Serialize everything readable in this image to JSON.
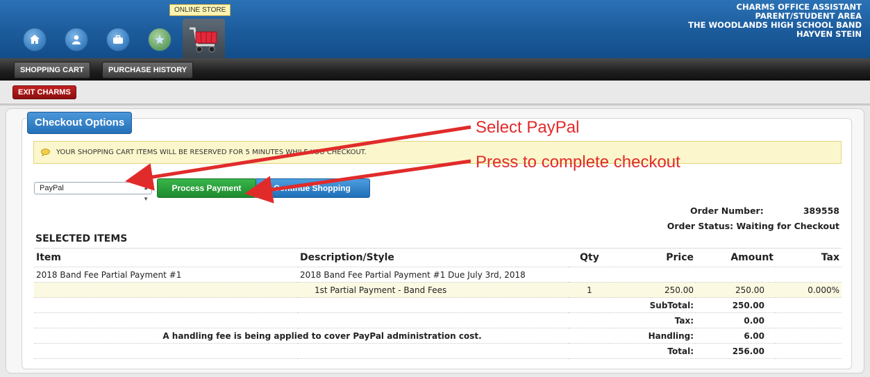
{
  "header": {
    "lines": [
      "CHARMS OFFICE ASSISTANT",
      "PARENT/STUDENT AREA",
      "THE WOODLANDS HIGH SCHOOL BAND",
      "HAYVEN STEIN"
    ],
    "store_tooltip": "ONLINE STORE",
    "icons": [
      "home-icon",
      "person-icon",
      "briefcase-icon",
      "star-icon",
      "shopping-cart-icon"
    ]
  },
  "subnav": {
    "shopping_cart": "SHOPPING CART",
    "purchase_history": "PURCHASE HISTORY",
    "exit": "EXIT CHARMS"
  },
  "checkout": {
    "title": "Checkout Options",
    "notice": "YOUR SHOPPING CART ITEMS WILL BE RESERVED FOR 5 MINUTES WHILE YOU CHECKOUT.",
    "payment_method": "PayPal",
    "process_button": "Process Payment",
    "continue_button": "Continue Shopping"
  },
  "order": {
    "number_label": "Order Number:",
    "number": "389558",
    "status_label": "Order Status:",
    "status": "Waiting for Checkout"
  },
  "items": {
    "section_title": "SELECTED ITEMS",
    "columns": [
      "Item",
      "Description/Style",
      "Qty",
      "Price",
      "Amount",
      "Tax"
    ],
    "item_name": "2018 Band Fee Partial Payment #1",
    "item_desc": "2018 Band Fee Partial Payment #1 Due July 3rd, 2018",
    "line_desc": "1st Partial Payment - Band Fees",
    "qty": "1",
    "price": "250.00",
    "amount": "250.00",
    "tax_rate": "0.000%"
  },
  "totals": {
    "subtotal_label": "SubTotal:",
    "subtotal": "250.00",
    "tax_label": "Tax:",
    "tax": "0.00",
    "handling_note": "A handling fee is being applied to cover PayPal administration cost.",
    "handling_label": "Handling:",
    "handling": "6.00",
    "total_label": "Total:",
    "total": "256.00"
  },
  "annotations": {
    "select_paypal": "Select PayPal",
    "press_complete": "Press to complete checkout",
    "color": "#e12b2b"
  }
}
